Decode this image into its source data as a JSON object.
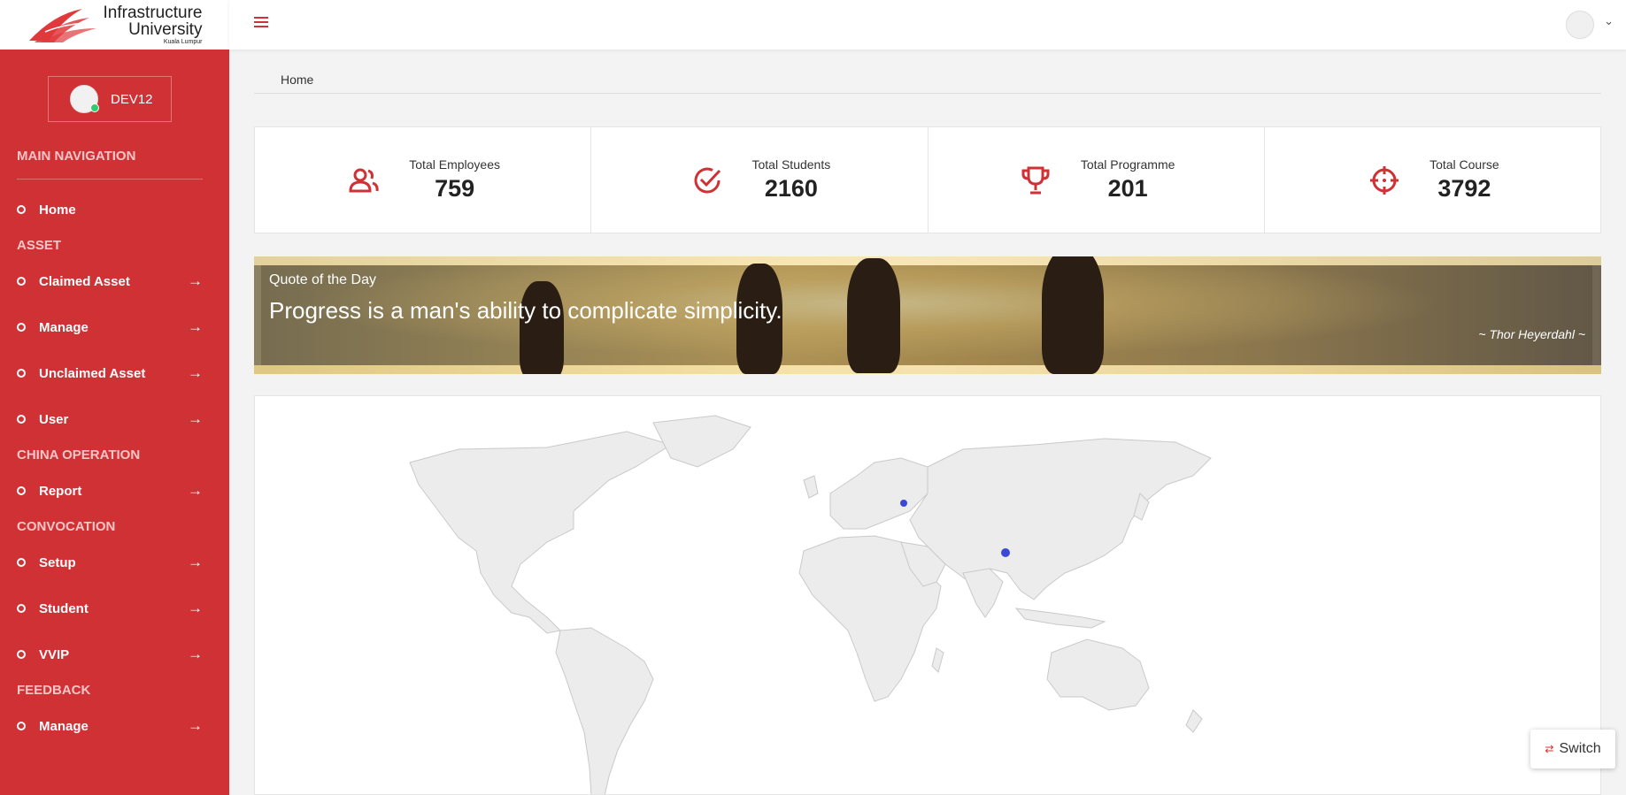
{
  "brand": {
    "line1": "Infrastructure",
    "line2": "University",
    "line3": "Kuala Lumpur"
  },
  "user": {
    "name": "DEV12"
  },
  "nav": {
    "sections": [
      {
        "title": "MAIN NAVIGATION",
        "items": [
          {
            "label": "Home",
            "arrow": false
          }
        ]
      },
      {
        "title": "ASSET",
        "items": [
          {
            "label": "Claimed Asset",
            "arrow": true
          },
          {
            "label": "Manage",
            "arrow": true
          },
          {
            "label": "Unclaimed Asset",
            "arrow": true
          },
          {
            "label": "User",
            "arrow": true
          }
        ]
      },
      {
        "title": "CHINA OPERATION",
        "items": [
          {
            "label": "Report",
            "arrow": true
          }
        ]
      },
      {
        "title": "CONVOCATION",
        "items": [
          {
            "label": "Setup",
            "arrow": true
          },
          {
            "label": "Student",
            "arrow": true
          },
          {
            "label": "VVIP",
            "arrow": true
          }
        ]
      },
      {
        "title": "FEEDBACK",
        "items": [
          {
            "label": "Manage",
            "arrow": true
          }
        ]
      }
    ]
  },
  "breadcrumb": {
    "current": "Home"
  },
  "stats": [
    {
      "label": "Total Employees",
      "value": "759",
      "icon": "users-icon"
    },
    {
      "label": "Total Students",
      "value": "2160",
      "icon": "check-circle-icon"
    },
    {
      "label": "Total Programme",
      "value": "201",
      "icon": "trophy-icon"
    },
    {
      "label": "Total Course",
      "value": "3792",
      "icon": "crosshair-icon"
    }
  ],
  "quote": {
    "title": "Quote of the Day",
    "text": "Progress is a man's ability to complicate simplicity.",
    "author": "~ Thor Heyerdahl ~"
  },
  "switch": {
    "label": "Switch"
  },
  "colors": {
    "accent": "#cf3135",
    "marker": "#3a48d6",
    "land": "#ececec"
  }
}
